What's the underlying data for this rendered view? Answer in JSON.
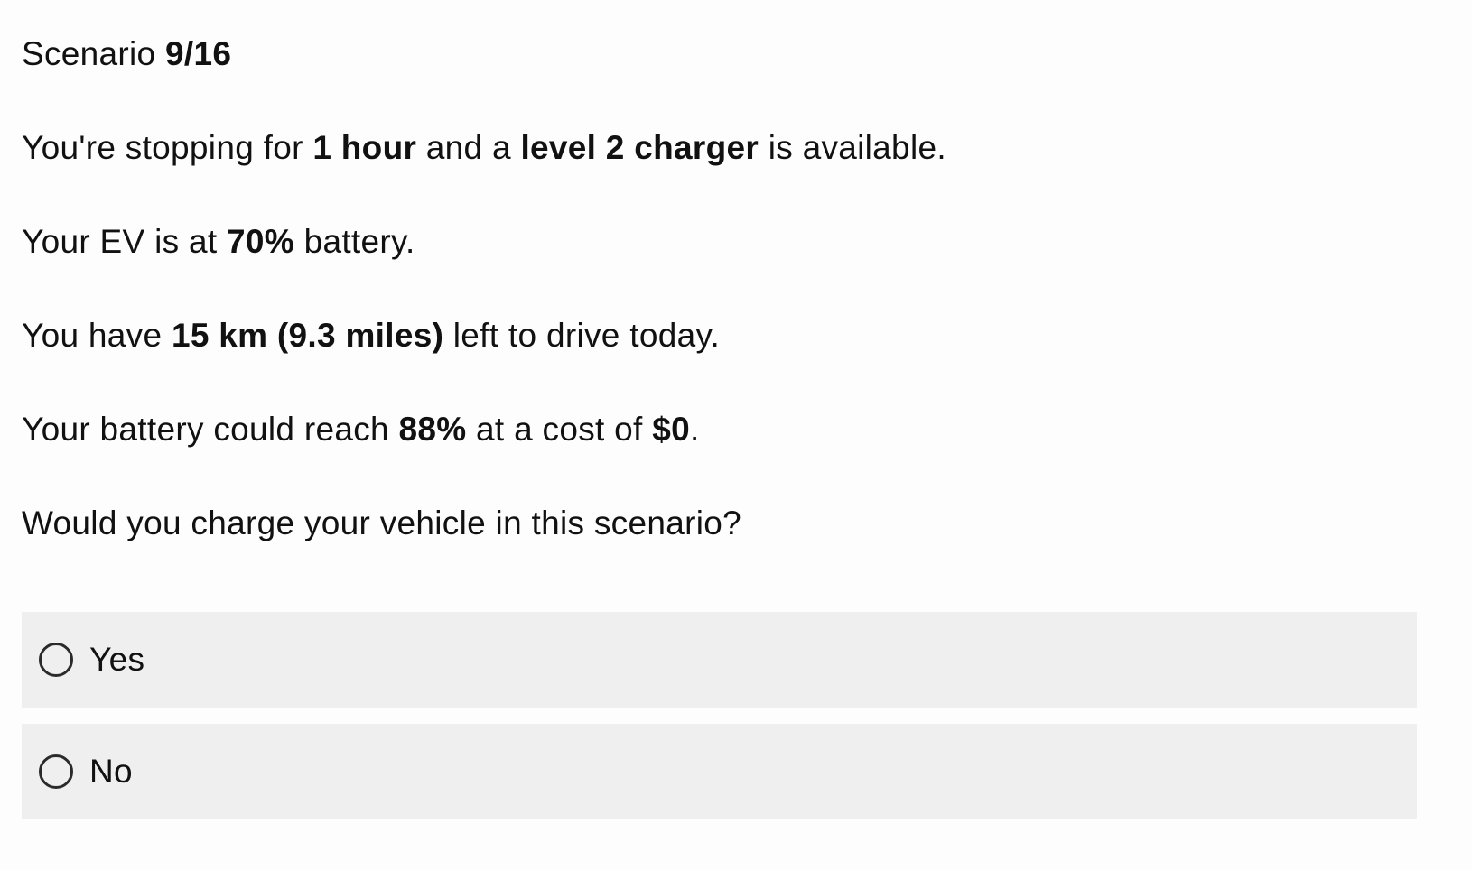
{
  "header": {
    "label": "Scenario",
    "progress": "9/16"
  },
  "scenario": {
    "stop": {
      "prefix": "You're stopping for ",
      "duration": "1 hour",
      "middle": " and a ",
      "charger": "level 2 charger",
      "suffix": " is available."
    },
    "battery": {
      "prefix": "Your EV is at ",
      "level": "70%",
      "suffix": " battery."
    },
    "distance": {
      "prefix": "You have ",
      "amount": "15 km (9.3 miles)",
      "suffix": " left to drive today."
    },
    "reach": {
      "prefix": "Your battery could reach ",
      "target": "88%",
      "middle": " at a cost of ",
      "cost": "$0",
      "suffix": "."
    }
  },
  "question": {
    "text": "Would you charge your vehicle in this scenario?",
    "options": [
      {
        "label": "Yes",
        "selected": false
      },
      {
        "label": "No",
        "selected": false
      }
    ]
  }
}
